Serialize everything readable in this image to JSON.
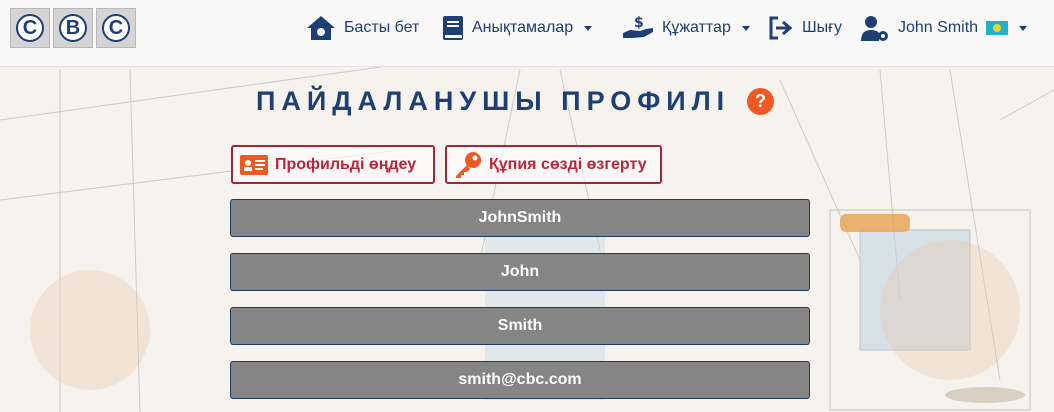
{
  "logo": {
    "letters": [
      "C",
      "B",
      "C"
    ]
  },
  "nav": {
    "home": "Басты бет",
    "references": "Анықтамалар",
    "documents": "Құжаттар",
    "logout": "Шығу",
    "user": "John Smith"
  },
  "page": {
    "title": "ПАЙДАЛАНУШЫ ПРОФИЛІ",
    "help_symbol": "?"
  },
  "actions": {
    "edit_profile": "Профильді өңдеу",
    "change_password": "Құпия сөзді өзгерту"
  },
  "profile": {
    "username": "JohnSmith",
    "first_name": "John",
    "last_name": "Smith",
    "email": "smith@cbc.com"
  },
  "colors": {
    "brand": "#1e3f73",
    "action": "#c0243a",
    "help": "#f05a22",
    "field_bg": "#858585"
  }
}
